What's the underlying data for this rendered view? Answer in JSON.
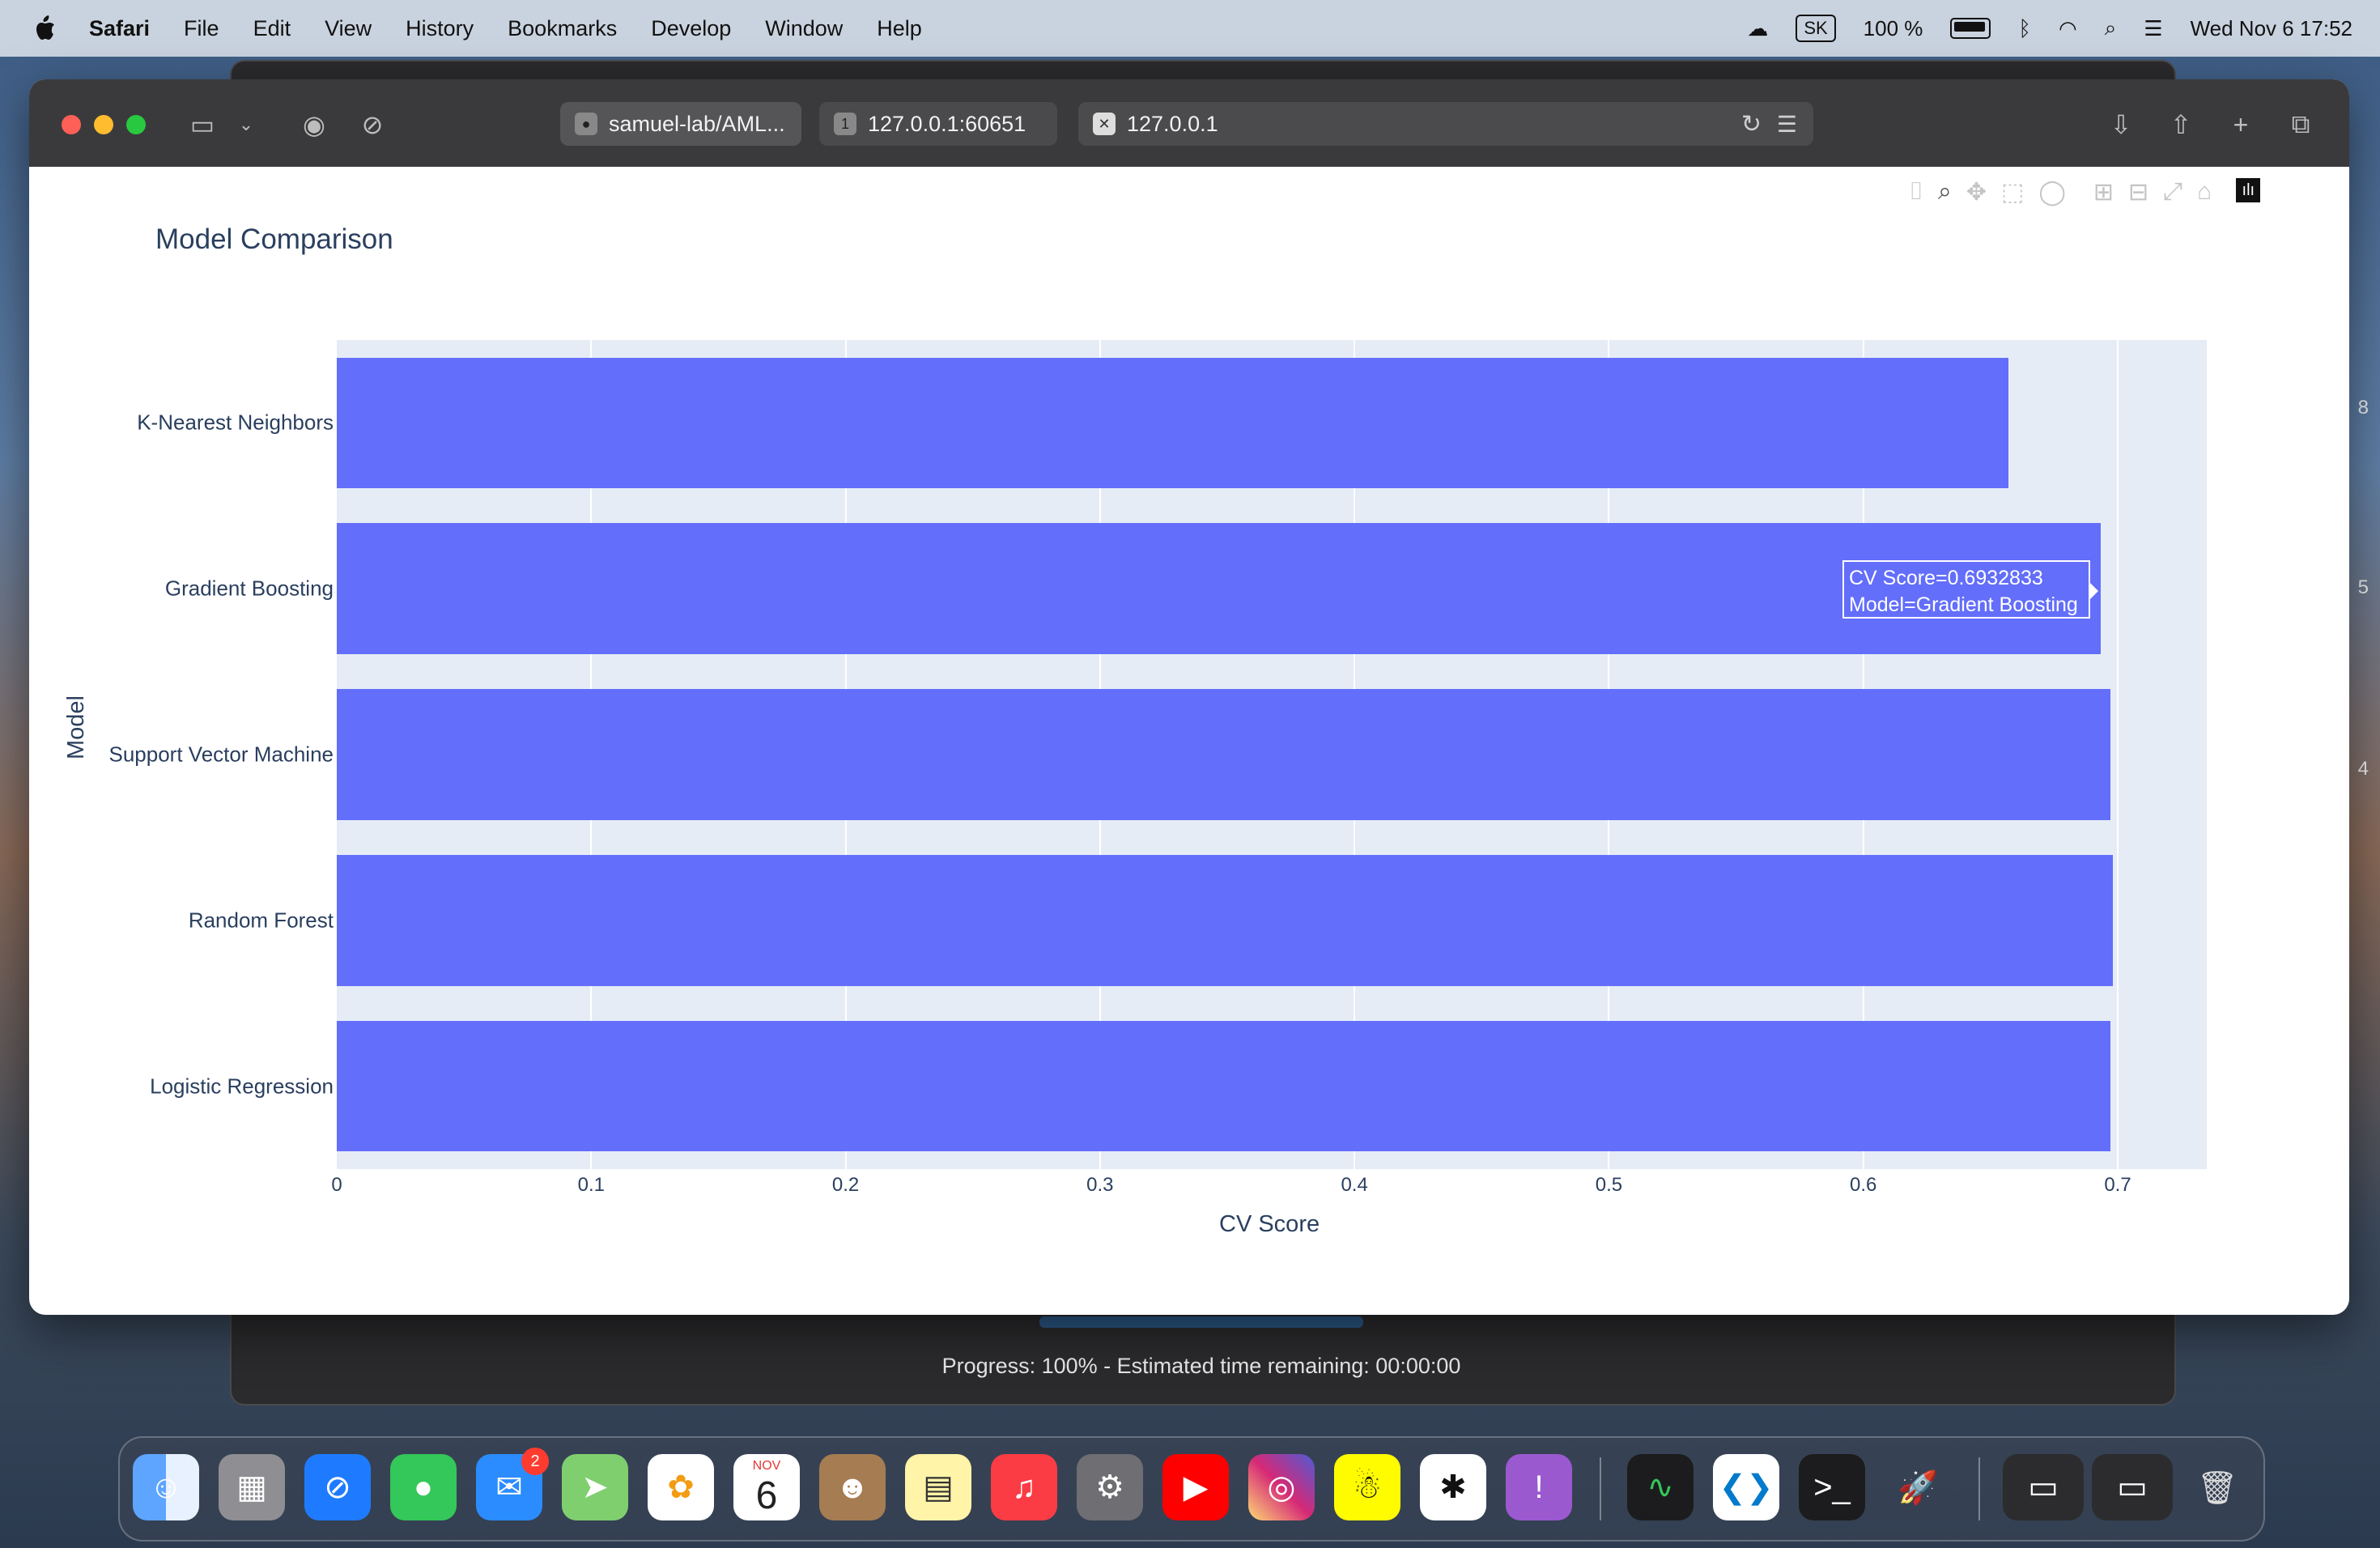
{
  "menubar": {
    "app": "Safari",
    "items": [
      "File",
      "Edit",
      "View",
      "History",
      "Bookmarks",
      "Develop",
      "Window",
      "Help"
    ],
    "kbd": "SK",
    "battery": "100 %",
    "datetime": "Wed Nov 6  17:52"
  },
  "browser": {
    "tabs": [
      {
        "title": "samuel-lab/AML...",
        "icon": "github-icon"
      },
      {
        "title": "127.0.0.1:60651",
        "icon": "1"
      },
      {
        "title": "127.0.0.1",
        "icon": "close-icon"
      }
    ]
  },
  "chart_data": {
    "type": "bar",
    "orientation": "horizontal",
    "title": "Model Comparison",
    "xlabel": "CV Score",
    "ylabel": "Model",
    "categories": [
      "K-Nearest Neighbors",
      "Gradient Boosting",
      "Support Vector Machine",
      "Random Forest",
      "Logistic Regression"
    ],
    "values": [
      0.657,
      0.6932833,
      0.697,
      0.698,
      0.697
    ],
    "xlim": [
      0,
      0.735
    ],
    "xticks": [
      "0",
      "0.1",
      "0.2",
      "0.3",
      "0.4",
      "0.5",
      "0.6",
      "0.7"
    ],
    "bar_color": "#636efa",
    "plot_bg": "#e5ecf6",
    "grid": true,
    "hover": {
      "line1": "CV Score=0.6932833",
      "line2": "Model=Gradient Boosting"
    }
  },
  "background_window": {
    "progress_text": "Progress: 100% - Estimated time remaining: 00:00:00"
  },
  "side_numbers": [
    "8",
    "5",
    "4"
  ],
  "dock": {
    "mail_badge": "2",
    "calendar_month": "NOV",
    "calendar_day": "6"
  }
}
